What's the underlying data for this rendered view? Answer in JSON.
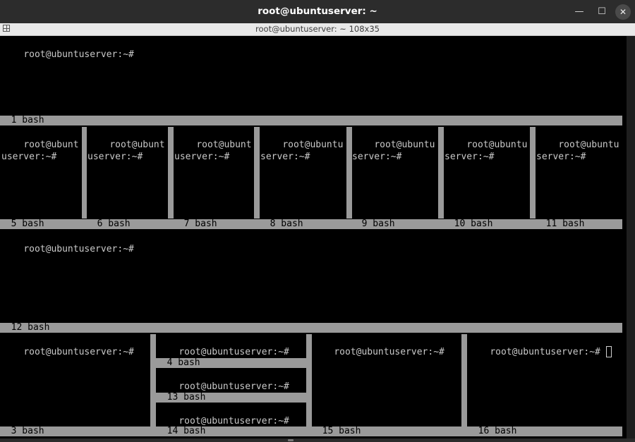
{
  "window": {
    "title": "root@ubuntuserver: ~",
    "subtitle": "root@ubuntuserver: ~ 108x35",
    "minimize_glyph": "—",
    "maximize_glyph": "☐",
    "close_glyph": "✕"
  },
  "prompt_full": "root@ubuntuserver:~#",
  "panes": [
    {
      "id": "1",
      "prompt": "root@ubuntuserver:~#",
      "status": "  1 bash"
    },
    {
      "id": "5",
      "prompt": "root@ubuntuserver:~#",
      "status": "  5 bash"
    },
    {
      "id": "6",
      "prompt": "root@ubuntuserver:~#",
      "status": "  6 bash"
    },
    {
      "id": "7",
      "prompt": "root@ubuntuserver:~#",
      "status": "  7 bash"
    },
    {
      "id": "8",
      "prompt": "root@ubuntuserver:~#",
      "status": "  8 bash"
    },
    {
      "id": "9",
      "prompt": "root@ubuntuserver:~#",
      "status": "  9 bash"
    },
    {
      "id": "10",
      "prompt": "root@ubuntuserver:~#",
      "status": "  10 bash"
    },
    {
      "id": "11",
      "prompt": "root@ubuntuserver:~#",
      "status": "  11 bash"
    },
    {
      "id": "12",
      "prompt": "root@ubuntuserver:~#",
      "status": "  12 bash"
    },
    {
      "id": "3",
      "prompt": "root@ubuntuserver:~#",
      "status": "  3 bash"
    },
    {
      "id": "4",
      "prompt": "root@ubuntuserver:~#",
      "status": "  4 bash"
    },
    {
      "id": "13",
      "prompt": "root@ubuntuserver:~#",
      "status": "  13 bash"
    },
    {
      "id": "14",
      "prompt": "root@ubuntuserver:~#",
      "status": "  14 bash"
    },
    {
      "id": "15",
      "prompt": "root@ubuntuserver:~#",
      "status": "  15 bash"
    },
    {
      "id": "16",
      "prompt": "root@ubuntuserver:~#",
      "status": "  16 bash"
    }
  ]
}
